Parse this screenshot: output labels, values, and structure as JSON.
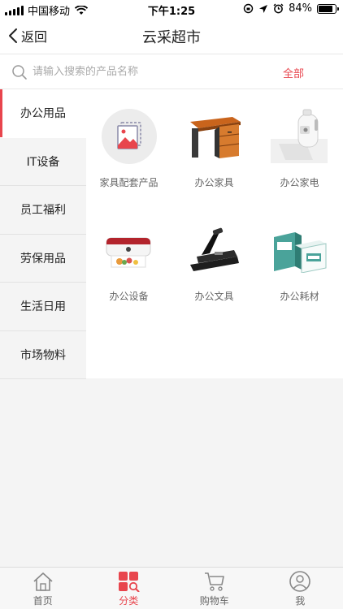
{
  "status_bar": {
    "carrier": "中国移动",
    "time": "下午1:25",
    "battery": "84%",
    "battery_level": 0.84
  },
  "nav": {
    "back_label": "返回",
    "title": "云采超市"
  },
  "search": {
    "placeholder": "请输入搜索的产品名称",
    "filter_label": "全部"
  },
  "sidebar": {
    "items": [
      {
        "label": "办公用品"
      },
      {
        "label": "IT设备"
      },
      {
        "label": "员工福利"
      },
      {
        "label": "劳保用品"
      },
      {
        "label": "生活日用"
      },
      {
        "label": "市场物料"
      }
    ]
  },
  "products": [
    {
      "label": "家具配套产品",
      "icon": "image-placeholder-icon"
    },
    {
      "label": "办公家具",
      "icon": "desk-icon"
    },
    {
      "label": "办公家电",
      "icon": "water-dispenser-icon"
    },
    {
      "label": "办公设备",
      "icon": "printer-icon"
    },
    {
      "label": "办公文具",
      "icon": "stapler-icon"
    },
    {
      "label": "办公耗材",
      "icon": "paper-box-icon"
    }
  ],
  "tabbar": {
    "items": [
      {
        "label": "首页",
        "icon": "home-icon"
      },
      {
        "label": "分类",
        "icon": "category-icon"
      },
      {
        "label": "购物车",
        "icon": "cart-icon"
      },
      {
        "label": "我",
        "icon": "user-icon"
      }
    ]
  },
  "colors": {
    "accent": "#e8454d",
    "background": "#f4f4f4"
  }
}
